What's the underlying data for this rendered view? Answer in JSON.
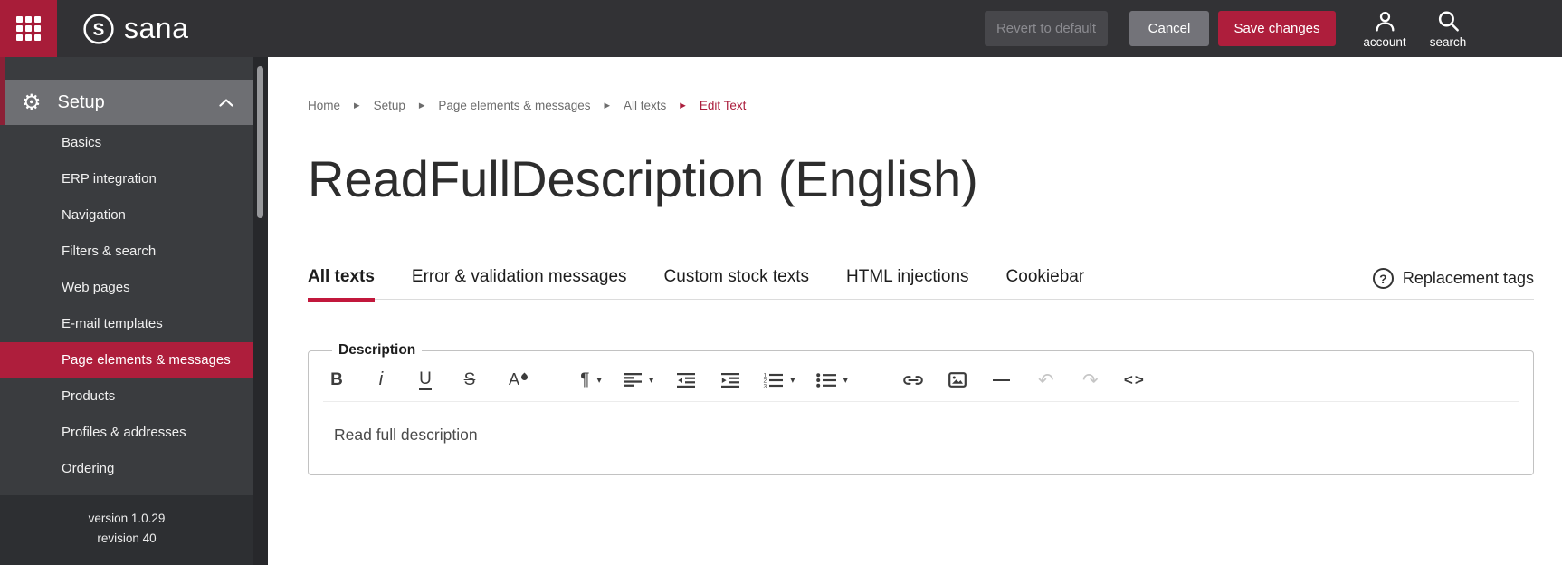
{
  "header": {
    "logo_text": "sana",
    "revert_label": "Revert to default",
    "cancel_label": "Cancel",
    "save_label": "Save changes",
    "account_label": "account",
    "search_label": "search"
  },
  "sidebar": {
    "setup_label": "Setup",
    "setup_icon": "⚙",
    "items": [
      {
        "label": "Basics",
        "active": false
      },
      {
        "label": "ERP integration",
        "active": false
      },
      {
        "label": "Navigation",
        "active": false
      },
      {
        "label": "Filters & search",
        "active": false
      },
      {
        "label": "Web pages",
        "active": false
      },
      {
        "label": "E-mail templates",
        "active": false
      },
      {
        "label": "Page elements & messages",
        "active": true
      },
      {
        "label": "Products",
        "active": false
      },
      {
        "label": "Profiles & addresses",
        "active": false
      },
      {
        "label": "Ordering",
        "active": false
      }
    ],
    "version_label": "version 1.0.29",
    "revision_label": "revision 40"
  },
  "breadcrumb": {
    "items": [
      "Home",
      "Setup",
      "Page elements & messages",
      "All texts"
    ],
    "current": "Edit Text",
    "separator": "▶"
  },
  "page": {
    "title": "ReadFullDescription (English)"
  },
  "tabs": {
    "items": [
      {
        "label": "All texts",
        "active": true
      },
      {
        "label": "Error & validation messages",
        "active": false
      },
      {
        "label": "Custom stock texts",
        "active": false
      },
      {
        "label": "HTML injections",
        "active": false
      },
      {
        "label": "Cookiebar",
        "active": false
      }
    ],
    "help_label": "Replacement tags",
    "help_icon": "?"
  },
  "editor": {
    "legend": "Description",
    "content": "Read full description",
    "toolbar": {
      "bold": "B",
      "italic": "i",
      "underline": "U",
      "strikethrough": "S",
      "text_color": "A",
      "paragraph": "¶",
      "caret": "▾",
      "horizontal_line": "—",
      "undo": "↶",
      "redo": "↷",
      "code": "<>"
    }
  },
  "colors": {
    "brand_red": "#ae1e3c",
    "header_bg": "#323235",
    "sidebar_bg": "#3a3c3f",
    "sidebar_footer_bg": "#2d2f32",
    "setup_bar_bg": "#6e6f73",
    "active_item_bg": "#ae1e3c",
    "breadcrumb_current": "#ab1d3c",
    "tab_underline": "#c2183c",
    "disabled_icon": "#c6c6c6"
  }
}
